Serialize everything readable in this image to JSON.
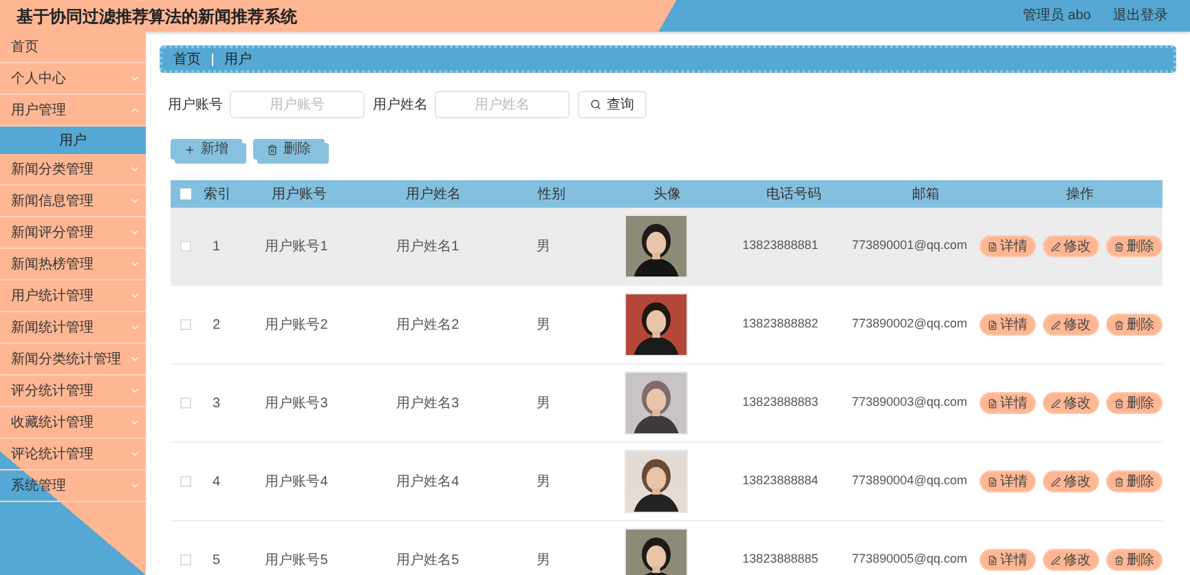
{
  "header": {
    "title": "基于协同过滤推荐算法的新闻推荐系统",
    "user": "管理员 abo",
    "logout": "退出登录"
  },
  "sidebar": {
    "items": [
      {
        "kind": "link",
        "label": "首页",
        "selected": false
      },
      {
        "kind": "group",
        "label": "个人中心",
        "expanded": false
      },
      {
        "kind": "group",
        "label": "用户管理",
        "expanded": true,
        "children": [
          {
            "label": "用户",
            "selected": true
          }
        ]
      },
      {
        "kind": "group",
        "label": "新闻分类管理",
        "expanded": false
      },
      {
        "kind": "group",
        "label": "新闻信息管理",
        "expanded": false
      },
      {
        "kind": "group",
        "label": "新闻评分管理",
        "expanded": false
      },
      {
        "kind": "group",
        "label": "新闻热榜管理",
        "expanded": false
      },
      {
        "kind": "group",
        "label": "用户统计管理",
        "expanded": false
      },
      {
        "kind": "group",
        "label": "新闻统计管理",
        "expanded": false
      },
      {
        "kind": "group",
        "label": "新闻分类统计管理",
        "expanded": false
      },
      {
        "kind": "group",
        "label": "评分统计管理",
        "expanded": false
      },
      {
        "kind": "group",
        "label": "收藏统计管理",
        "expanded": false
      },
      {
        "kind": "group",
        "label": "评论统计管理",
        "expanded": false
      },
      {
        "kind": "group",
        "label": "系统管理",
        "expanded": false
      }
    ]
  },
  "breadcrumb": [
    "首页",
    "用户"
  ],
  "search": {
    "fields": [
      {
        "label": "用户账号",
        "placeholder": "用户账号"
      },
      {
        "label": "用户姓名",
        "placeholder": "用户姓名"
      }
    ],
    "button": "查询"
  },
  "actions": [
    {
      "kind": "add",
      "label": "新增"
    },
    {
      "kind": "delete",
      "label": "删除"
    }
  ],
  "table": {
    "all_checked": false,
    "columns": [
      "索引",
      "用户账号",
      "用户姓名",
      "性别",
      "头像",
      "电话号码",
      "邮箱",
      "操作"
    ],
    "rows": [
      {
        "checked": false,
        "hovered": true,
        "index": "1",
        "account": "用户账号1",
        "name": "用户姓名1",
        "gender": "男",
        "phone": "13823888881",
        "email": "773890001@qq.com",
        "actions": [
          {
            "kind": "detail",
            "label": "详情"
          },
          {
            "kind": "edit",
            "label": "修改"
          },
          {
            "kind": "delete",
            "label": "删除"
          }
        ]
      },
      {
        "checked": false,
        "hovered": false,
        "index": "2",
        "account": "用户账号2",
        "name": "用户姓名2",
        "gender": "男",
        "phone": "13823888882",
        "email": "773890002@qq.com",
        "actions": [
          {
            "kind": "detail",
            "label": "详情"
          },
          {
            "kind": "edit",
            "label": "修改"
          },
          {
            "kind": "delete",
            "label": "删除"
          }
        ]
      },
      {
        "checked": false,
        "hovered": false,
        "index": "3",
        "account": "用户账号3",
        "name": "用户姓名3",
        "gender": "男",
        "phone": "13823888883",
        "email": "773890003@qq.com",
        "actions": [
          {
            "kind": "detail",
            "label": "详情"
          },
          {
            "kind": "edit",
            "label": "修改"
          },
          {
            "kind": "delete",
            "label": "删除"
          }
        ]
      },
      {
        "checked": false,
        "hovered": false,
        "index": "4",
        "account": "用户账号4",
        "name": "用户姓名4",
        "gender": "男",
        "phone": "13823888884",
        "email": "773890004@qq.com",
        "actions": [
          {
            "kind": "detail",
            "label": "详情"
          },
          {
            "kind": "edit",
            "label": "修改"
          },
          {
            "kind": "delete",
            "label": "删除"
          }
        ]
      },
      {
        "checked": false,
        "hovered": false,
        "index": "5",
        "account": "用户账号5",
        "name": "用户姓名5",
        "gender": "男",
        "phone": "13823888885",
        "email": "773890005@qq.com",
        "actions": [
          {
            "kind": "detail",
            "label": "详情"
          },
          {
            "kind": "edit",
            "label": "修改"
          },
          {
            "kind": "delete",
            "label": "删除"
          }
        ]
      }
    ]
  }
}
